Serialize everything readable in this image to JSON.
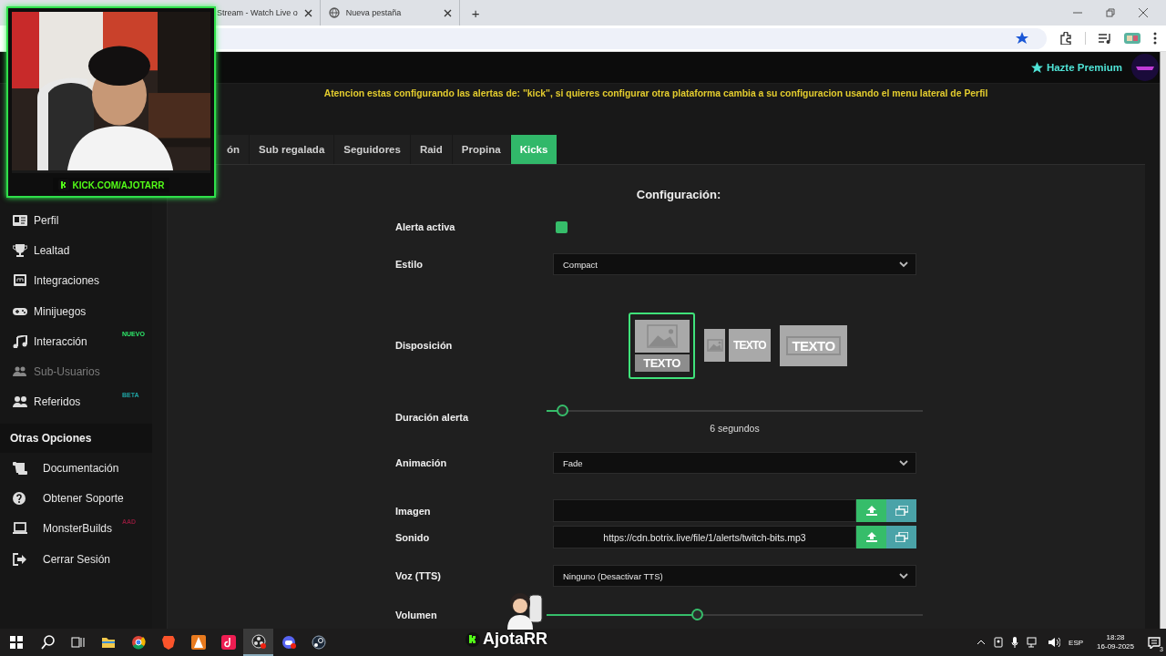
{
  "browser": {
    "tabs": [
      {
        "title": "Stream - Watch Live o",
        "selected": false
      },
      {
        "title": "Nueva pestaña",
        "selected": false
      }
    ],
    "new_tab": "+"
  },
  "header": {
    "premium": "Hazte Premium"
  },
  "notice": "Atencion estas configurando las alertas de: \"kick\", si quieres configurar otra plataforma cambia a su configuracion usando el menu lateral de Perfil",
  "sidebar": {
    "items": [
      {
        "label": "Perfil",
        "disabled": false
      },
      {
        "label": "Lealtad",
        "disabled": false
      },
      {
        "label": "Integraciones",
        "disabled": false
      },
      {
        "label": "Minijuegos",
        "disabled": false
      },
      {
        "label": "Interacción",
        "disabled": false,
        "badge": "NUEVO",
        "color": "#2ee86a"
      },
      {
        "label": "Sub-Usuarios",
        "disabled": true
      },
      {
        "label": "Referidos",
        "disabled": false,
        "badge": "BETA",
        "color": "#1fa3a3"
      }
    ],
    "section_title": "Otras Opciones",
    "other_items": [
      {
        "label": "Documentación"
      },
      {
        "label": "Obtener Soporte"
      },
      {
        "label": "MonsterBuilds",
        "badge": "AAD",
        "color": "#8b1a3a"
      },
      {
        "label": "Cerrar Sesión"
      }
    ]
  },
  "alert_tabs": [
    {
      "label": "ón",
      "selected": false
    },
    {
      "label": "Sub regalada",
      "selected": false
    },
    {
      "label": "Seguidores",
      "selected": false
    },
    {
      "label": "Raid",
      "selected": false
    },
    {
      "label": "Propina",
      "selected": false
    },
    {
      "label": "Kicks",
      "selected": true
    }
  ],
  "config": {
    "title": "Configuración:",
    "rows": [
      {
        "kind": "toggle",
        "label": "Alerta activa",
        "checked": true
      },
      {
        "kind": "select",
        "label": "Estilo",
        "value": "Compact"
      },
      {
        "kind": "layout",
        "label": "Disposición",
        "options": [
          {
            "kind": "stacked",
            "text": "TEXTO",
            "selected": true
          },
          {
            "kind": "side",
            "text": "TEXTO",
            "selected": false
          },
          {
            "kind": "overlay",
            "text": "TEXTO",
            "selected": false
          }
        ]
      },
      {
        "kind": "slider",
        "label": "Duración alerta",
        "level": 0.04,
        "reading": "6 segundos"
      },
      {
        "kind": "select",
        "label": "Animación",
        "value": "Fade"
      },
      {
        "kind": "file",
        "label": "Imagen"
      },
      {
        "kind": "file",
        "label": "Sonido",
        "value": "https://cdn.botrix.live/file/1/alerts/twitch-bits.mp3"
      },
      {
        "kind": "select",
        "label": "Voz (TTS)",
        "value": "Ninguno (Desactivar TTS)"
      },
      {
        "kind": "slider",
        "label": "Volumen",
        "level": 0.4
      }
    ]
  },
  "stream_overlay": {
    "channel_url": "KICK.COM/AJOTARR",
    "streamer_name": "AjotaRR"
  },
  "taskbar": {
    "language": "ESP",
    "time": "18:28",
    "date": "16-09-2025",
    "notifications": "3"
  }
}
